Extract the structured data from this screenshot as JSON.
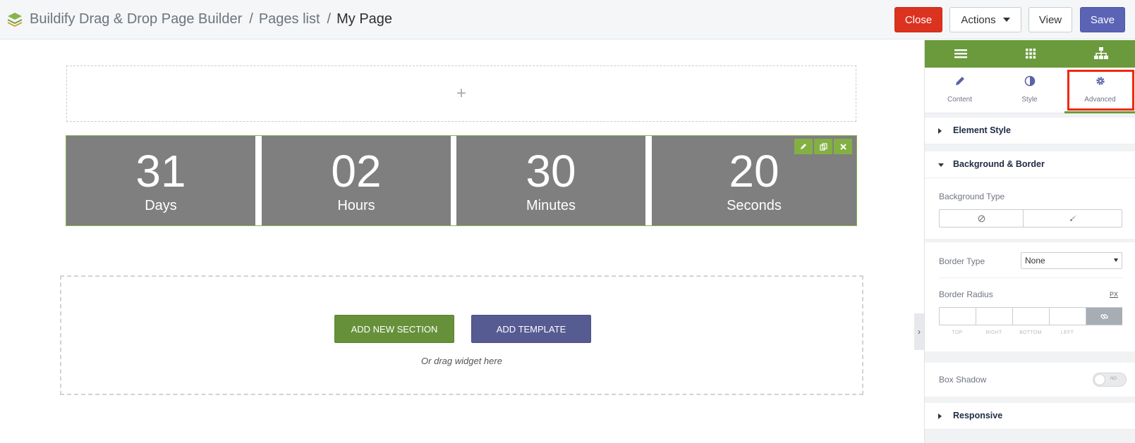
{
  "topbar": {
    "breadcrumb": [
      {
        "label": "Buildify Drag & Drop Page Builder"
      },
      {
        "label": "Pages list"
      },
      {
        "label": "My Page"
      }
    ],
    "separator": "/",
    "buttons": {
      "close": "Close",
      "actions": "Actions",
      "view": "View",
      "save": "Save"
    },
    "colors": {
      "close": "#dc3220",
      "save": "#5b63b5"
    }
  },
  "canvas": {
    "top_drop_icon": "+",
    "countdown": [
      {
        "value": "31",
        "label": "Days"
      },
      {
        "value": "02",
        "label": "Hours"
      },
      {
        "value": "30",
        "label": "Minutes"
      },
      {
        "value": "20",
        "label": "Seconds"
      }
    ],
    "widget_tools": [
      "pencil-icon",
      "duplicate-icon",
      "close-icon"
    ],
    "drop_zone": {
      "add_section": "ADD NEW SECTION",
      "add_template": "ADD TEMPLATE",
      "hint": "Or drag widget here"
    }
  },
  "panel": {
    "top_icons": [
      "hamburger-icon",
      "grid-icon",
      "sitemap-icon"
    ],
    "tabs": [
      {
        "label": "Content",
        "icon": "pencil-icon"
      },
      {
        "label": "Style",
        "icon": "contrast-icon"
      },
      {
        "label": "Advanced",
        "icon": "gear-icon",
        "active": true
      }
    ],
    "sections": {
      "element_style": "Element Style",
      "background_border": "Background & Border",
      "responsive": "Responsive"
    },
    "controls": {
      "background_type": "Background Type",
      "border_type": "Border Type",
      "border_type_value": "None",
      "border_radius": "Border Radius",
      "unit": "PX",
      "radius_labels": [
        "TOP",
        "RIGHT",
        "BOTTOM",
        "LEFT"
      ],
      "box_shadow": "Box Shadow",
      "toggle_off": "NO"
    },
    "accent": "#6a9a3b"
  }
}
